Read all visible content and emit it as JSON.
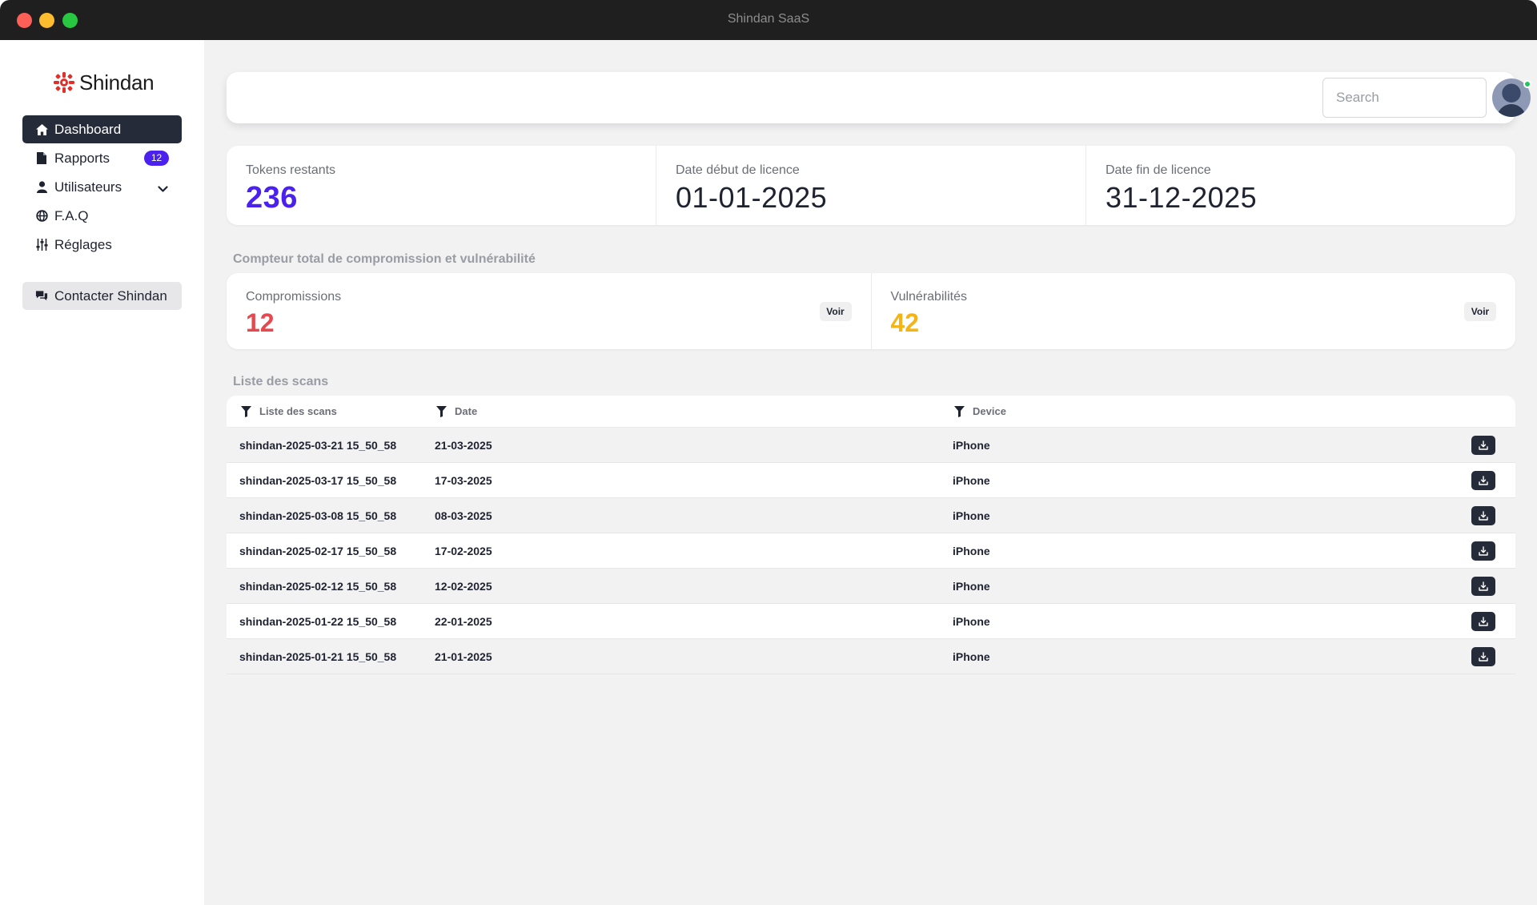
{
  "window": {
    "title": "Shindan SaaS"
  },
  "brand": {
    "name": "Shindan",
    "accent": "#4b21f0",
    "logo_color": "#e1302b"
  },
  "sidebar": {
    "items": [
      {
        "label": "Dashboard",
        "icon": "home-icon",
        "active": true
      },
      {
        "label": "Rapports",
        "icon": "document-icon",
        "badge": "12"
      },
      {
        "label": "Utilisateurs",
        "icon": "user-icon",
        "expandable": true
      },
      {
        "label": "F.A.Q",
        "icon": "globe-icon"
      },
      {
        "label": "Réglages",
        "icon": "sliders-icon"
      }
    ],
    "contact": {
      "label": "Contacter Shindan",
      "icon": "chat-icon"
    }
  },
  "header": {
    "search_placeholder": "Search",
    "avatar_status": "online"
  },
  "stats": {
    "tokens": {
      "label": "Tokens restants",
      "value": "236"
    },
    "start": {
      "label": "Date début de licence",
      "value": "01-01-2025"
    },
    "end": {
      "label": "Date fin de licence",
      "value": "31-12-2025"
    }
  },
  "counters": {
    "title": "Compteur total de compromission et vulnérabilité",
    "compromissions": {
      "label": "Compromissions",
      "value": "12",
      "color": "#e5484d",
      "action": "Voir"
    },
    "vulnerabilites": {
      "label": "Vulnérabilités",
      "value": "42",
      "color": "#f5b416",
      "action": "Voir"
    }
  },
  "scans": {
    "title": "Liste des scans",
    "columns": [
      "Liste des scans",
      "Date",
      "Device"
    ],
    "rows": [
      {
        "name": "shindan-2025-03-21 15_50_58",
        "date": "21-03-2025",
        "device": "iPhone"
      },
      {
        "name": "shindan-2025-03-17 15_50_58",
        "date": "17-03-2025",
        "device": "iPhone"
      },
      {
        "name": "shindan-2025-03-08 15_50_58",
        "date": "08-03-2025",
        "device": "iPhone"
      },
      {
        "name": "shindan-2025-02-17 15_50_58",
        "date": "17-02-2025",
        "device": "iPhone"
      },
      {
        "name": "shindan-2025-02-12 15_50_58",
        "date": "12-02-2025",
        "device": "iPhone"
      },
      {
        "name": "shindan-2025-01-22 15_50_58",
        "date": "22-01-2025",
        "device": "iPhone"
      },
      {
        "name": "shindan-2025-01-21 15_50_58",
        "date": "21-01-2025",
        "device": "iPhone"
      }
    ]
  }
}
